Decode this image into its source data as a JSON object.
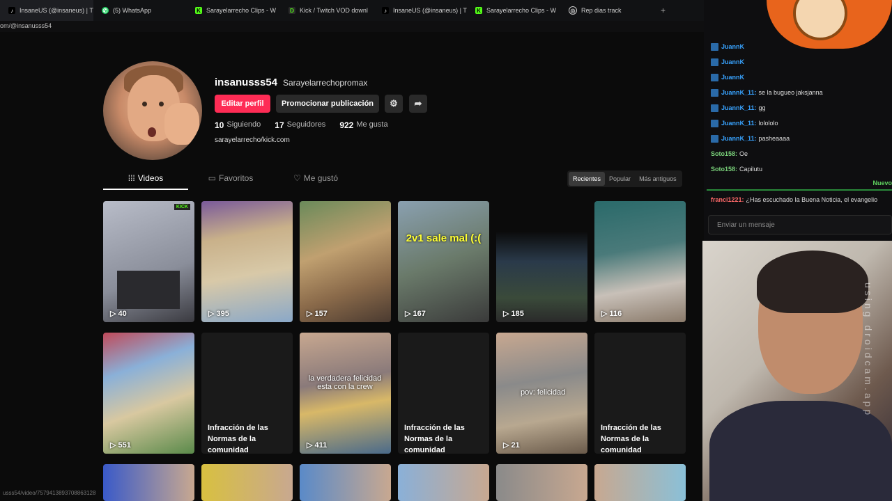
{
  "browser": {
    "tabs": [
      {
        "label": "InsaneUS (@insaneus) | T",
        "icon": "tiktok-icon",
        "active": true
      },
      {
        "label": "(5) WhatsApp",
        "icon": "whatsapp-icon"
      },
      {
        "label": "Sarayelarrecho Clips - W",
        "icon": "kick-icon"
      },
      {
        "label": "Kick / Twitch VOD downl",
        "icon": "download-icon"
      },
      {
        "label": "InsaneUS (@insaneus) | T",
        "icon": "tiktok-icon"
      },
      {
        "label": "Sarayelarrecho Clips - W",
        "icon": "kick-icon"
      },
      {
        "label": "Rep dias track",
        "icon": "globe-icon"
      }
    ],
    "url": "om/@insanusss54",
    "status_link": "usss54/video/7579413893708863128"
  },
  "profile": {
    "username": "insanusss54",
    "nickname": "Sarayelarrechopromax",
    "edit_label": "Editar perfil",
    "promo_label": "Promocionar publicación",
    "following_count": "10",
    "following_label": "Siguiendo",
    "followers_count": "17",
    "followers_label": "Seguidores",
    "likes_count": "922",
    "likes_label": "Me gusta",
    "bio": "sarayelarrecho/kick.com"
  },
  "tabs": {
    "videos": "Videos",
    "favorites": "Favoritos",
    "liked": "Me gustó"
  },
  "sort": {
    "recent": "Recientes",
    "popular": "Popular",
    "oldest": "Más antiguos"
  },
  "videos": [
    {
      "views": "40",
      "badge": "KICK"
    },
    {
      "views": "395"
    },
    {
      "views": "157"
    },
    {
      "views": "167",
      "overlay": "2v1 sale mal (:("
    },
    {
      "views": "185"
    },
    {
      "views": "116"
    },
    {
      "views": "551"
    },
    {
      "restricted": "Infracción de las Normas de la comunidad"
    },
    {
      "views": "411",
      "overlay": "la verdadera felicidad esta con la crew"
    },
    {
      "restricted": "Infracción de las Normas de la comunidad"
    },
    {
      "views": "21",
      "overlay": "pov: felicidad"
    },
    {
      "restricted": "Infracción de las Normas de la comunidad"
    }
  ],
  "chat": {
    "messages": [
      {
        "user": "JuannK",
        "text": ""
      },
      {
        "user": "JuannK",
        "text": ""
      },
      {
        "user": "JuannK",
        "text": ""
      },
      {
        "user": "JuannK_11:",
        "text": "se la bugueo jaksjanna"
      },
      {
        "user": "JuannK_11:",
        "text": "gg"
      },
      {
        "user": "JuannK_11:",
        "text": "lolololo"
      },
      {
        "user": "JuannK_11:",
        "text": "pasheaaaa"
      },
      {
        "user": "Soto158:",
        "text": "Oe"
      },
      {
        "user": "Soto158:",
        "text": "Capilutu"
      }
    ],
    "new_label": "Nuevo",
    "last_user": "franci1221:",
    "last_text": "¿Has escuchado la Buena Noticia, el evangelio",
    "input_placeholder": "Enviar un mensaje",
    "colors": {
      "juann": "#38a3ff",
      "soto": "#7bd37b",
      "franci": "#ff6a6a"
    }
  },
  "webcam": {
    "watermark": "using droidcam.app"
  }
}
